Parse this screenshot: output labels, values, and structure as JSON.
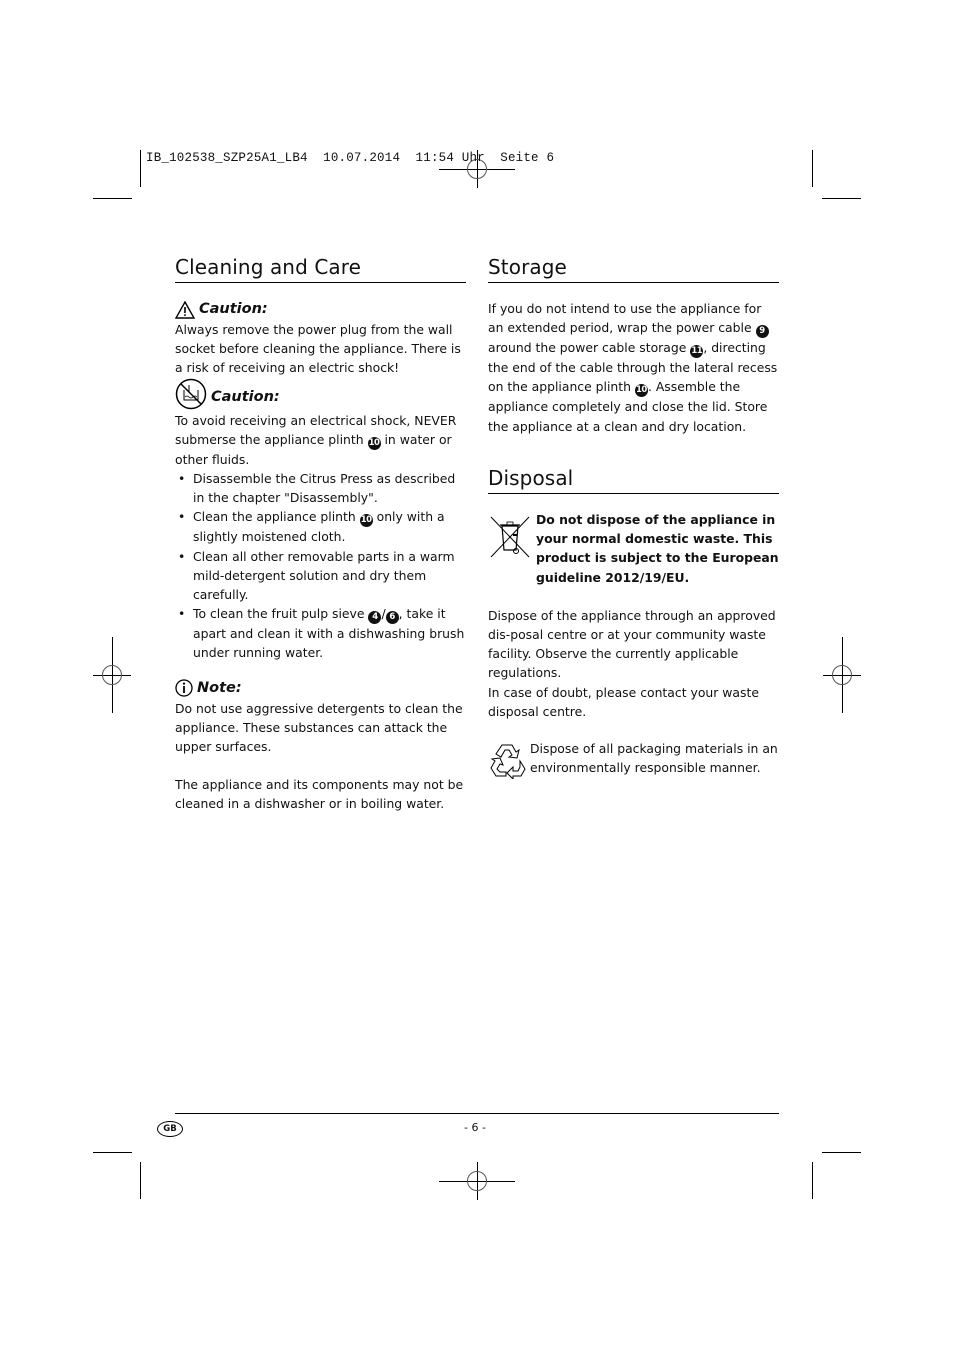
{
  "print_slug": "IB_102538_SZP25A1_LB4  10.07.2014  11:54 Uhr  Seite 6",
  "left_column": {
    "title": "Cleaning and Care",
    "caution1": {
      "label": "Caution:",
      "icon": "warning-triangle-icon",
      "text": "Always remove the power plug from the wall socket before cleaning the appliance. There is a risk of receiving an electric shock!"
    },
    "caution2": {
      "label": "Caution:",
      "icon": "no-submerge-icon",
      "text_part1": "To avoid receiving an electrical shock, NEVER submerse the appliance plinth ",
      "text_ref": "10",
      "text_part2": " in water or other fluids."
    },
    "bullets": [
      {
        "text": "Disassemble the Citrus Press as described in the chapter \"Disassembly\"."
      },
      {
        "part1": "Clean the appliance plinth ",
        "ref": "10",
        "part2": " only with a slightly moistened cloth."
      },
      {
        "text": "Clean all other removable parts in a warm mild-detergent solution and dry them carefully."
      },
      {
        "part1": "To clean the fruit pulp sieve ",
        "ref1": "4",
        "sep": "/",
        "ref2": "6",
        "part2": ", take it apart and clean it with a dishwashing brush under running water."
      }
    ],
    "note": {
      "label": "Note:",
      "icon": "info-icon",
      "text1": "Do not use aggressive detergents to clean the appliance. These substances can attack the upper surfaces.",
      "text2": "The appliance and its components may not be cleaned in a dishwasher or in boiling water."
    }
  },
  "right_column": {
    "storage": {
      "title": "Storage",
      "p1": "If you do not intend to use the appliance for an extended period, wrap the power cable ",
      "ref1": "9",
      "p2": " around the power cable storage ",
      "ref2": "11",
      "p3": ", directing the end of the cable through the lateral recess on the appliance plinth ",
      "ref3": "10",
      "p4": ". Assemble the appliance completely and close the lid. Store the appliance at a clean and dry location."
    },
    "disposal": {
      "title": "Disposal",
      "weee_text": "Do not dispose of the appliance in your normal domestic waste. This product is subject to the European guideline 2012/19/EU.",
      "text1": "Dispose of the appliance through an approved dis-posal centre or at your community waste facility. Observe the currently applicable regulations.",
      "text2": "In case of doubt, please contact your waste disposal centre.",
      "recycle_text": "Dispose of all packaging materials in an environmentally responsible manner."
    }
  },
  "footer": {
    "country_badge": "GB",
    "page_number": "- 6 -"
  }
}
